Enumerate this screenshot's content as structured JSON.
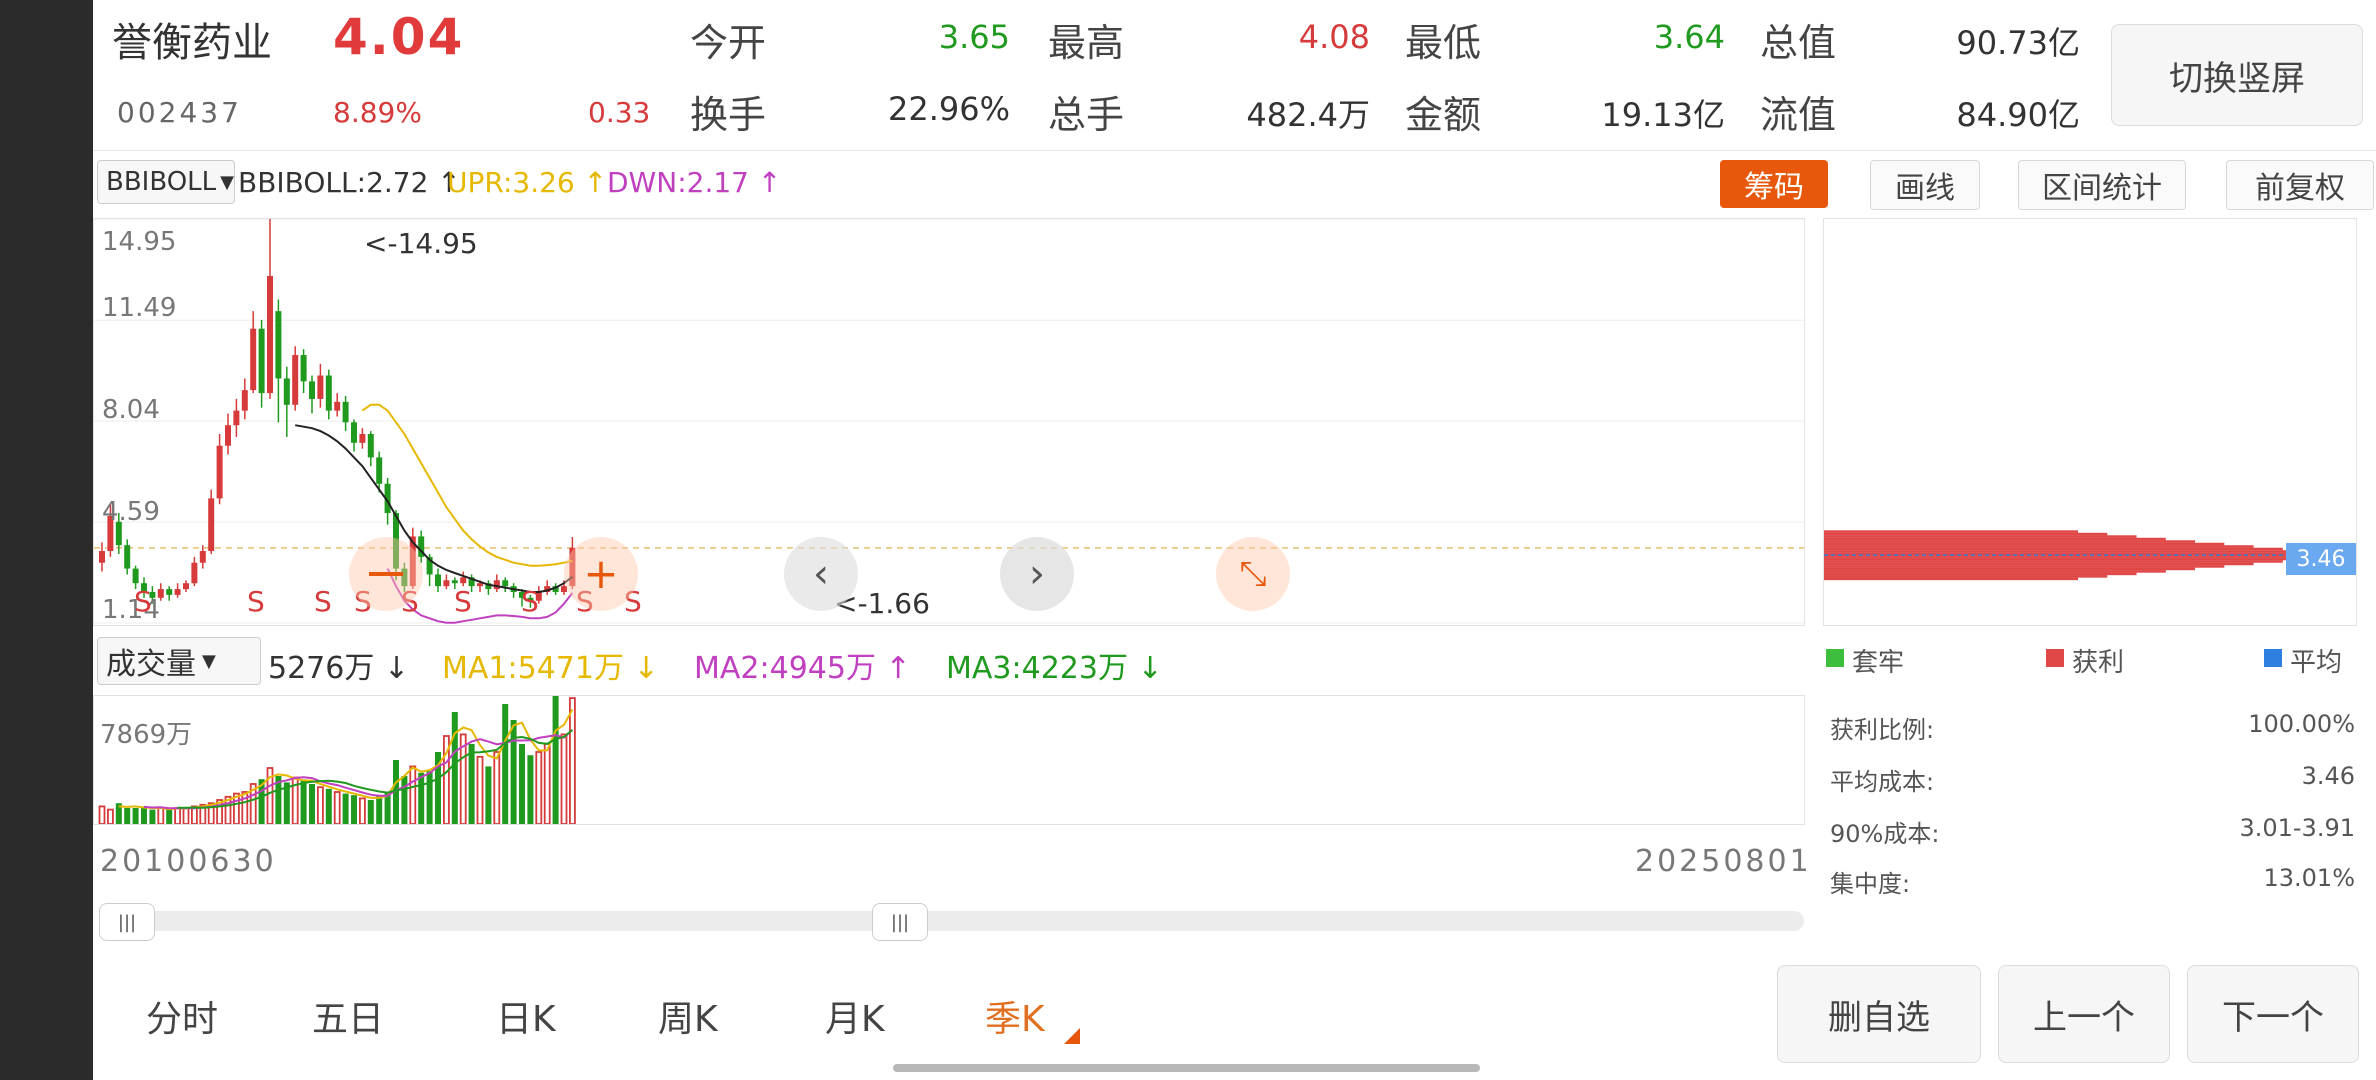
{
  "stock": {
    "name": "誉衡药业",
    "price": "4.04",
    "code": "002437",
    "change_pct": "8.89%",
    "change_amt": "0.33"
  },
  "quote": {
    "open_label": "今开",
    "open": "3.65",
    "high_label": "最高",
    "high": "4.08",
    "low_label": "最低",
    "low": "3.64",
    "mktcap_label": "总值",
    "mktcap": "90.73亿",
    "turnover_label": "换手",
    "turnover": "22.96%",
    "volume_label": "总手",
    "volume": "482.4万",
    "amount_label": "金额",
    "amount": "19.13亿",
    "float_label": "流值",
    "float": "84.90亿"
  },
  "switch_button": "切换竖屏",
  "indicator": {
    "selector": "BBIBOLL",
    "bbiboll": "BBIBOLL:2.72 ↑",
    "upr": "UPR:3.26 ↑",
    "dwn": "DWN:2.17 ↑"
  },
  "tools": {
    "chips": "筹码",
    "draw": "画线",
    "range_stats": "区间统计",
    "adjust": "前复权"
  },
  "kline": {
    "y_labels": [
      "14.95",
      "11.49",
      "8.04",
      "4.59",
      "1.14"
    ],
    "max_marker": "<-14.95",
    "min_marker": "<-1.66",
    "s_label": "S"
  },
  "volume_panel": {
    "selector": "成交量",
    "vol": "5276万 ↓",
    "ma1": "MA1:5471万 ↓",
    "ma2": "MA2:4945万 ↑",
    "ma3": "MA3:4223万 ↓",
    "max_label": "7869万"
  },
  "dates": {
    "start": "20100630",
    "end": "20250801"
  },
  "chips": {
    "avg_tag": "3.46",
    "legend_trapped": "套牢",
    "legend_profit": "获利",
    "legend_avg": "平均",
    "profit_ratio_label": "获利比例:",
    "profit_ratio": "100.00%",
    "avg_cost_label": "平均成本:",
    "avg_cost": "3.46",
    "cost90_label": "90%成本:",
    "cost90": "3.01-3.91",
    "concentration_label": "集中度:",
    "concentration": "13.01%"
  },
  "periods": [
    "分时",
    "五日",
    "日K",
    "周K",
    "月K",
    "季K"
  ],
  "bottom_buttons": {
    "delete": "删自选",
    "prev": "上一个",
    "next": "下一个"
  },
  "colors": {
    "up": "#d63a3a",
    "down": "#1f9a1f",
    "accent": "#e8580c",
    "ma_yellow": "#e6b800",
    "ma_purple": "#c040c0",
    "ma_black": "#222222"
  },
  "chart_data": {
    "type": "candlestick",
    "title": "",
    "ylim": [
      1.14,
      14.95
    ],
    "y_ticks": [
      14.95,
      11.49,
      8.04,
      4.59,
      1.14
    ],
    "x_range": [
      "20100630",
      "20250801"
    ],
    "candles": [
      [
        3.2,
        3.6,
        2.9,
        3.9
      ],
      [
        3.6,
        4.8,
        3.4,
        5.2
      ],
      [
        4.6,
        3.8,
        3.5,
        4.9
      ],
      [
        3.8,
        3.0,
        2.8,
        4.0
      ],
      [
        3.0,
        2.5,
        2.3,
        3.1
      ],
      [
        2.5,
        2.2,
        2.0,
        2.7
      ],
      [
        2.2,
        2.0,
        1.8,
        2.4
      ],
      [
        2.0,
        2.3,
        1.9,
        2.5
      ],
      [
        2.3,
        2.1,
        1.9,
        2.4
      ],
      [
        2.1,
        2.3,
        2.0,
        2.5
      ],
      [
        2.3,
        2.5,
        2.2,
        2.6
      ],
      [
        2.5,
        3.2,
        2.4,
        3.4
      ],
      [
        3.2,
        3.6,
        3.0,
        3.8
      ],
      [
        3.6,
        5.4,
        3.5,
        5.7
      ],
      [
        5.4,
        7.2,
        5.2,
        7.6
      ],
      [
        7.2,
        7.9,
        6.9,
        8.3
      ],
      [
        7.9,
        8.4,
        7.5,
        8.8
      ],
      [
        8.4,
        9.1,
        8.1,
        9.5
      ],
      [
        9.1,
        11.2,
        9.0,
        11.8
      ],
      [
        11.2,
        9.0,
        8.5,
        11.5
      ],
      [
        9.0,
        13.0,
        8.8,
        14.95
      ],
      [
        11.8,
        9.5,
        8.0,
        12.2
      ],
      [
        9.5,
        8.6,
        7.5,
        9.9
      ],
      [
        8.6,
        10.3,
        8.4,
        10.6
      ],
      [
        10.3,
        9.4,
        9.0,
        10.5
      ],
      [
        9.4,
        8.8,
        8.3,
        9.6
      ],
      [
        8.8,
        9.6,
        8.5,
        10.0
      ],
      [
        9.6,
        8.4,
        8.1,
        9.8
      ],
      [
        8.4,
        8.7,
        8.2,
        9.0
      ],
      [
        8.7,
        8.0,
        7.7,
        8.9
      ],
      [
        8.0,
        7.3,
        7.0,
        8.1
      ],
      [
        7.3,
        7.6,
        7.1,
        7.8
      ],
      [
        7.6,
        6.8,
        6.5,
        7.7
      ],
      [
        6.8,
        5.9,
        5.6,
        7.0
      ],
      [
        5.9,
        4.9,
        4.5,
        6.1
      ],
      [
        4.9,
        3.0,
        2.6,
        5.0
      ],
      [
        3.0,
        2.4,
        2.2,
        3.2
      ],
      [
        2.4,
        4.1,
        2.3,
        4.4
      ],
      [
        4.1,
        3.4,
        3.2,
        4.3
      ],
      [
        3.4,
        2.8,
        2.4,
        3.5
      ],
      [
        2.8,
        2.4,
        2.2,
        3.0
      ],
      [
        2.4,
        2.6,
        2.3,
        2.8
      ],
      [
        2.6,
        2.5,
        2.3,
        2.7
      ],
      [
        2.5,
        2.7,
        2.4,
        2.9
      ],
      [
        2.7,
        2.4,
        2.2,
        2.8
      ],
      [
        2.4,
        2.5,
        2.2,
        2.6
      ],
      [
        2.5,
        2.3,
        2.1,
        2.6
      ],
      [
        2.3,
        2.6,
        2.2,
        2.8
      ],
      [
        2.6,
        2.4,
        2.2,
        2.7
      ],
      [
        2.4,
        2.2,
        2.0,
        2.5
      ],
      [
        2.2,
        2.0,
        1.7,
        2.3
      ],
      [
        2.0,
        1.9,
        1.66,
        2.1
      ],
      [
        1.9,
        2.2,
        1.8,
        2.4
      ],
      [
        2.2,
        2.4,
        2.1,
        2.6
      ],
      [
        2.4,
        2.2,
        2.1,
        2.5
      ],
      [
        2.2,
        2.4,
        2.1,
        2.6
      ],
      [
        2.4,
        3.71,
        2.3,
        4.08
      ]
    ],
    "series": [
      {
        "name": "BBIBOLL",
        "values": [
          null,
          null,
          null,
          null,
          null,
          null,
          null,
          null,
          null,
          null,
          null,
          null,
          null,
          null,
          null,
          null,
          null,
          null,
          null,
          null,
          null,
          null,
          null,
          7.9,
          7.85,
          7.8,
          7.7,
          7.55,
          7.35,
          7.1,
          6.8,
          6.5,
          6.1,
          5.7,
          5.3,
          4.8,
          4.3,
          3.9,
          3.6,
          3.3,
          3.1,
          2.95,
          2.85,
          2.75,
          2.65,
          2.55,
          2.45,
          2.4,
          2.35,
          2.3,
          2.25,
          2.2,
          2.2,
          2.25,
          2.35,
          2.5,
          2.72
        ]
      },
      {
        "name": "UPR",
        "values": [
          null,
          null,
          null,
          null,
          null,
          null,
          null,
          null,
          null,
          null,
          null,
          null,
          null,
          null,
          null,
          null,
          null,
          null,
          null,
          null,
          null,
          null,
          null,
          null,
          null,
          null,
          null,
          null,
          null,
          null,
          null,
          8.4,
          8.6,
          8.6,
          8.4,
          8.0,
          7.6,
          7.1,
          6.6,
          6.1,
          5.6,
          5.1,
          4.7,
          4.3,
          4.0,
          3.75,
          3.55,
          3.4,
          3.3,
          3.2,
          3.15,
          3.1,
          3.1,
          3.12,
          3.15,
          3.2,
          3.26
        ]
      },
      {
        "name": "DWN",
        "values": [
          null,
          null,
          null,
          null,
          null,
          null,
          null,
          null,
          null,
          null,
          null,
          null,
          null,
          null,
          null,
          null,
          null,
          null,
          null,
          null,
          null,
          null,
          null,
          null,
          null,
          null,
          null,
          null,
          null,
          null,
          null,
          null,
          null,
          null,
          3.0,
          2.4,
          1.9,
          1.6,
          1.4,
          1.3,
          1.2,
          1.15,
          1.15,
          1.2,
          1.25,
          1.3,
          1.35,
          1.4,
          1.4,
          1.38,
          1.35,
          1.3,
          1.3,
          1.35,
          1.5,
          1.8,
          2.17
        ]
      }
    ],
    "volume": {
      "max_label": "7869万",
      "values": [
        1100,
        900,
        1300,
        1000,
        1000,
        1100,
        900,
        1000,
        900,
        1000,
        1000,
        1100,
        1200,
        1300,
        1500,
        1700,
        1900,
        2000,
        2500,
        2800,
        3500,
        3000,
        2600,
        2900,
        2700,
        2500,
        2300,
        2200,
        2000,
        1900,
        1800,
        1600,
        1500,
        1800,
        2000,
        4000,
        3000,
        3600,
        3200,
        3300,
        4500,
        5500,
        7000,
        5600,
        5000,
        4200,
        3600,
        4500,
        7500,
        6500,
        5000,
        4300,
        4500,
        5000,
        8000,
        5600,
        7869
      ]
    },
    "chip_distribution": {
      "avg_cost": 3.46,
      "range": [
        3.01,
        3.91
      ]
    }
  }
}
